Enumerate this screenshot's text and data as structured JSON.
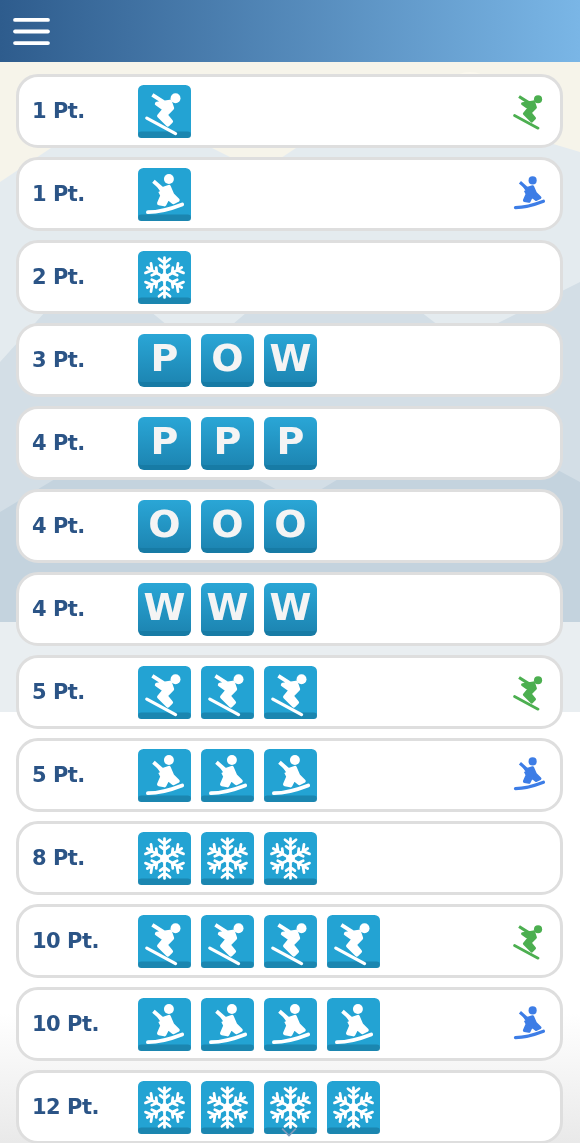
{
  "rows": [
    {
      "points": "1 Pt.",
      "tiles": [
        {
          "kind": "ski"
        }
      ],
      "sport_badge": {
        "kind": "ski"
      }
    },
    {
      "points": "1 Pt.",
      "tiles": [
        {
          "kind": "snowboard"
        }
      ],
      "sport_badge": {
        "kind": "snowboard"
      }
    },
    {
      "points": "2 Pt.",
      "tiles": [
        {
          "kind": "snowflake"
        }
      ]
    },
    {
      "points": "3 Pt.",
      "tiles": [
        {
          "kind": "letter",
          "letter": "P"
        },
        {
          "kind": "letter",
          "letter": "O"
        },
        {
          "kind": "letter",
          "letter": "W"
        }
      ]
    },
    {
      "points": "4 Pt.",
      "tiles": [
        {
          "kind": "letter",
          "letter": "P"
        },
        {
          "kind": "letter",
          "letter": "P"
        },
        {
          "kind": "letter",
          "letter": "P"
        }
      ]
    },
    {
      "points": "4 Pt.",
      "tiles": [
        {
          "kind": "letter",
          "letter": "O"
        },
        {
          "kind": "letter",
          "letter": "O"
        },
        {
          "kind": "letter",
          "letter": "O"
        }
      ]
    },
    {
      "points": "4 Pt.",
      "tiles": [
        {
          "kind": "letter",
          "letter": "W"
        },
        {
          "kind": "letter",
          "letter": "W"
        },
        {
          "kind": "letter",
          "letter": "W"
        }
      ]
    },
    {
      "points": "5 Pt.",
      "tiles": [
        {
          "kind": "ski"
        },
        {
          "kind": "ski"
        },
        {
          "kind": "ski"
        }
      ],
      "sport_badge": {
        "kind": "ski"
      }
    },
    {
      "points": "5 Pt.",
      "tiles": [
        {
          "kind": "snowboard"
        },
        {
          "kind": "snowboard"
        },
        {
          "kind": "snowboard"
        }
      ],
      "sport_badge": {
        "kind": "snowboard"
      }
    },
    {
      "points": "8 Pt.",
      "tiles": [
        {
          "kind": "snowflake"
        },
        {
          "kind": "snowflake"
        },
        {
          "kind": "snowflake"
        }
      ]
    },
    {
      "points": "10 Pt.",
      "tiles": [
        {
          "kind": "ski"
        },
        {
          "kind": "ski"
        },
        {
          "kind": "ski"
        },
        {
          "kind": "ski"
        }
      ],
      "sport_badge": {
        "kind": "ski"
      }
    },
    {
      "points": "10 Pt.",
      "tiles": [
        {
          "kind": "snowboard"
        },
        {
          "kind": "snowboard"
        },
        {
          "kind": "snowboard"
        },
        {
          "kind": "snowboard"
        }
      ],
      "sport_badge": {
        "kind": "snowboard"
      }
    },
    {
      "points": "12 Pt.",
      "tiles": [
        {
          "kind": "snowflake"
        },
        {
          "kind": "snowflake"
        },
        {
          "kind": "snowflake"
        },
        {
          "kind": "snowflake"
        }
      ]
    }
  ]
}
